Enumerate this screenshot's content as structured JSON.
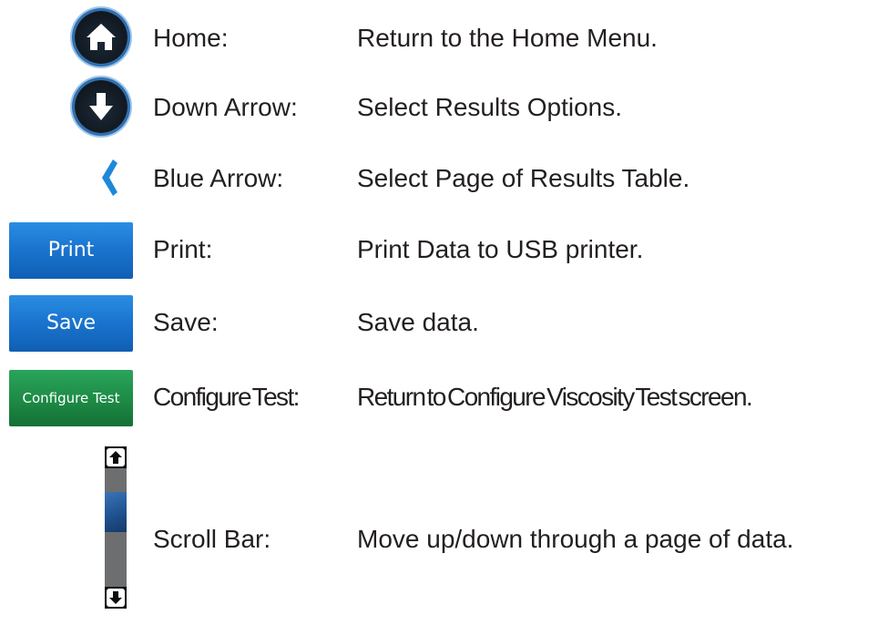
{
  "rows": [
    {
      "term": "Home:",
      "desc": "Return to the Home Menu.",
      "icon": "home-icon"
    },
    {
      "term": "Down Arrow:",
      "desc": "Select Results Options.",
      "icon": "down-arrow-icon"
    },
    {
      "term": "Blue Arrow:",
      "desc": "Select Page of Results Table.",
      "icon": "blue-arrow-left-icon"
    },
    {
      "term": "Print:",
      "desc": "Print Data to USB printer.",
      "button": "Print"
    },
    {
      "term": "Save:",
      "desc": "Save data.",
      "button": "Save"
    },
    {
      "term": "Configure Test:",
      "desc": "Return to Configure Viscosity Test screen.",
      "button": "Configure Test"
    },
    {
      "term": "Scroll Bar:",
      "desc": "Move up/down through a page of data.",
      "icon": "scroll-bar-icon"
    }
  ],
  "colors": {
    "blue_button": "#1b75d0",
    "green_button": "#1d8a45",
    "blue_arrow": "#1e88d8",
    "text": "#231f20"
  }
}
